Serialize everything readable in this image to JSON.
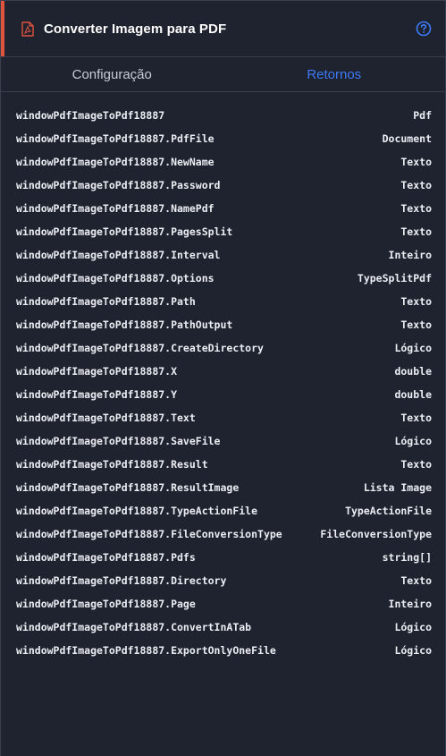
{
  "header": {
    "title": "Converter Imagem para PDF",
    "pdf_icon": "file-pdf-icon",
    "help_icon": "question-circle-icon",
    "accent_color": "#e0533d"
  },
  "tabs": [
    {
      "label": "Configuração",
      "active": false
    },
    {
      "label": "Retornos",
      "active": true
    }
  ],
  "returns": [
    {
      "name": "windowPdfImageToPdf18887",
      "type": "Pdf"
    },
    {
      "name": "windowPdfImageToPdf18887.PdfFile",
      "type": "Document"
    },
    {
      "name": "windowPdfImageToPdf18887.NewName",
      "type": "Texto"
    },
    {
      "name": "windowPdfImageToPdf18887.Password",
      "type": "Texto"
    },
    {
      "name": "windowPdfImageToPdf18887.NamePdf",
      "type": "Texto"
    },
    {
      "name": "windowPdfImageToPdf18887.PagesSplit",
      "type": "Texto"
    },
    {
      "name": "windowPdfImageToPdf18887.Interval",
      "type": "Inteiro"
    },
    {
      "name": "windowPdfImageToPdf18887.Options",
      "type": "TypeSplitPdf"
    },
    {
      "name": "windowPdfImageToPdf18887.Path",
      "type": "Texto"
    },
    {
      "name": "windowPdfImageToPdf18887.PathOutput",
      "type": "Texto"
    },
    {
      "name": "windowPdfImageToPdf18887.CreateDirectory",
      "type": "Lógico"
    },
    {
      "name": "windowPdfImageToPdf18887.X",
      "type": "double"
    },
    {
      "name": "windowPdfImageToPdf18887.Y",
      "type": "double"
    },
    {
      "name": "windowPdfImageToPdf18887.Text",
      "type": "Texto"
    },
    {
      "name": "windowPdfImageToPdf18887.SaveFile",
      "type": "Lógico"
    },
    {
      "name": "windowPdfImageToPdf18887.Result",
      "type": "Texto"
    },
    {
      "name": "windowPdfImageToPdf18887.ResultImage",
      "type": "Lista Image"
    },
    {
      "name": "windowPdfImageToPdf18887.TypeActionFile",
      "type": "TypeActionFile"
    },
    {
      "name": "windowPdfImageToPdf18887.FileConversionType",
      "type": "FileConversionType"
    },
    {
      "name": "windowPdfImageToPdf18887.Pdfs",
      "type": "string[]"
    },
    {
      "name": "windowPdfImageToPdf18887.Directory",
      "type": "Texto"
    },
    {
      "name": "windowPdfImageToPdf18887.Page",
      "type": "Inteiro"
    },
    {
      "name": "windowPdfImageToPdf18887.ConvertInATab",
      "type": "Lógico"
    },
    {
      "name": "windowPdfImageToPdf18887.ExportOnlyOneFile",
      "type": "Lógico"
    }
  ]
}
